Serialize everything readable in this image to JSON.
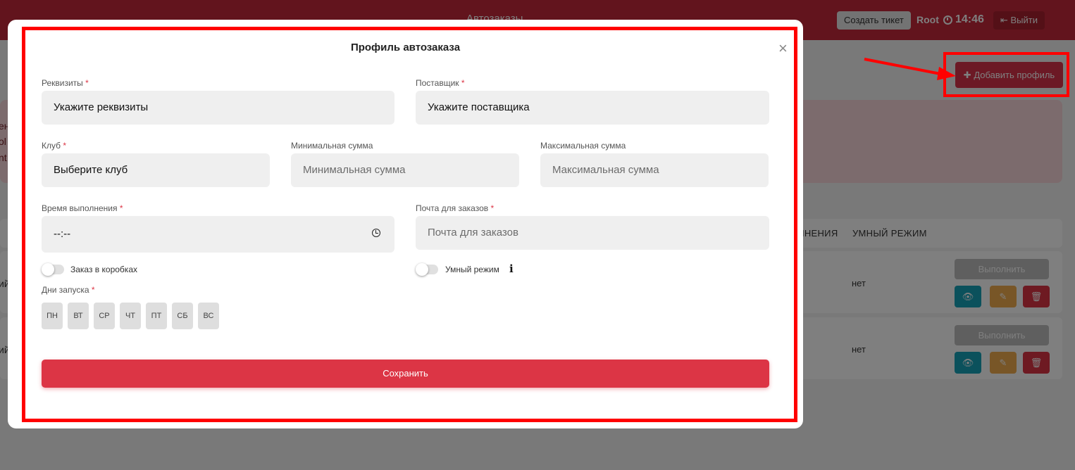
{
  "header": {
    "app_title": "Автозаказы",
    "create_ticket": "Создать тикет",
    "user": "Root",
    "time": "14:46",
    "logout": "Выйти"
  },
  "page": {
    "add_profile": "Добавить профиль",
    "alert_fragments": [
      "ен",
      "ol",
      "nt"
    ],
    "table_headers": [
      "ЛНЕНИЯ",
      "УМНЫЙ РЕЖИМ"
    ],
    "rows": [
      {
        "name_fragment": "ий",
        "smart_mode": "нет",
        "run": "Выполнить"
      },
      {
        "name_fragment": "ий",
        "smart_mode": "нет",
        "run": "Выполнить"
      }
    ]
  },
  "modal": {
    "title": "Профиль автозаказа",
    "close": "×",
    "requisites": {
      "label": "Реквизиты",
      "value": "Укажите реквизиты"
    },
    "supplier": {
      "label": "Поставщик",
      "value": "Укажите поставщика"
    },
    "club": {
      "label": "Клуб",
      "value": "Выберите клуб"
    },
    "min_sum": {
      "label": "Минимальная сумма",
      "placeholder": "Минимальная сумма"
    },
    "max_sum": {
      "label": "Максимальная сумма",
      "placeholder": "Максимальная сумма"
    },
    "exec_time": {
      "label": "Время выполнения",
      "value": "--:--"
    },
    "email": {
      "label": "Почта для заказов",
      "placeholder": "Почта для заказов"
    },
    "boxes_toggle": {
      "label": "Заказ в коробках",
      "on": false
    },
    "smart_toggle": {
      "label": "Умный режим",
      "on": false
    },
    "days_label": "Дни запуска",
    "days": [
      "ПН",
      "ВТ",
      "СР",
      "ЧТ",
      "ПТ",
      "СБ",
      "ВС"
    ],
    "required_mark": "*",
    "save": "Сохранить"
  },
  "colors": {
    "primary": "#dc3545",
    "highlight": "#ff0000",
    "field_bg": "#efefef"
  }
}
